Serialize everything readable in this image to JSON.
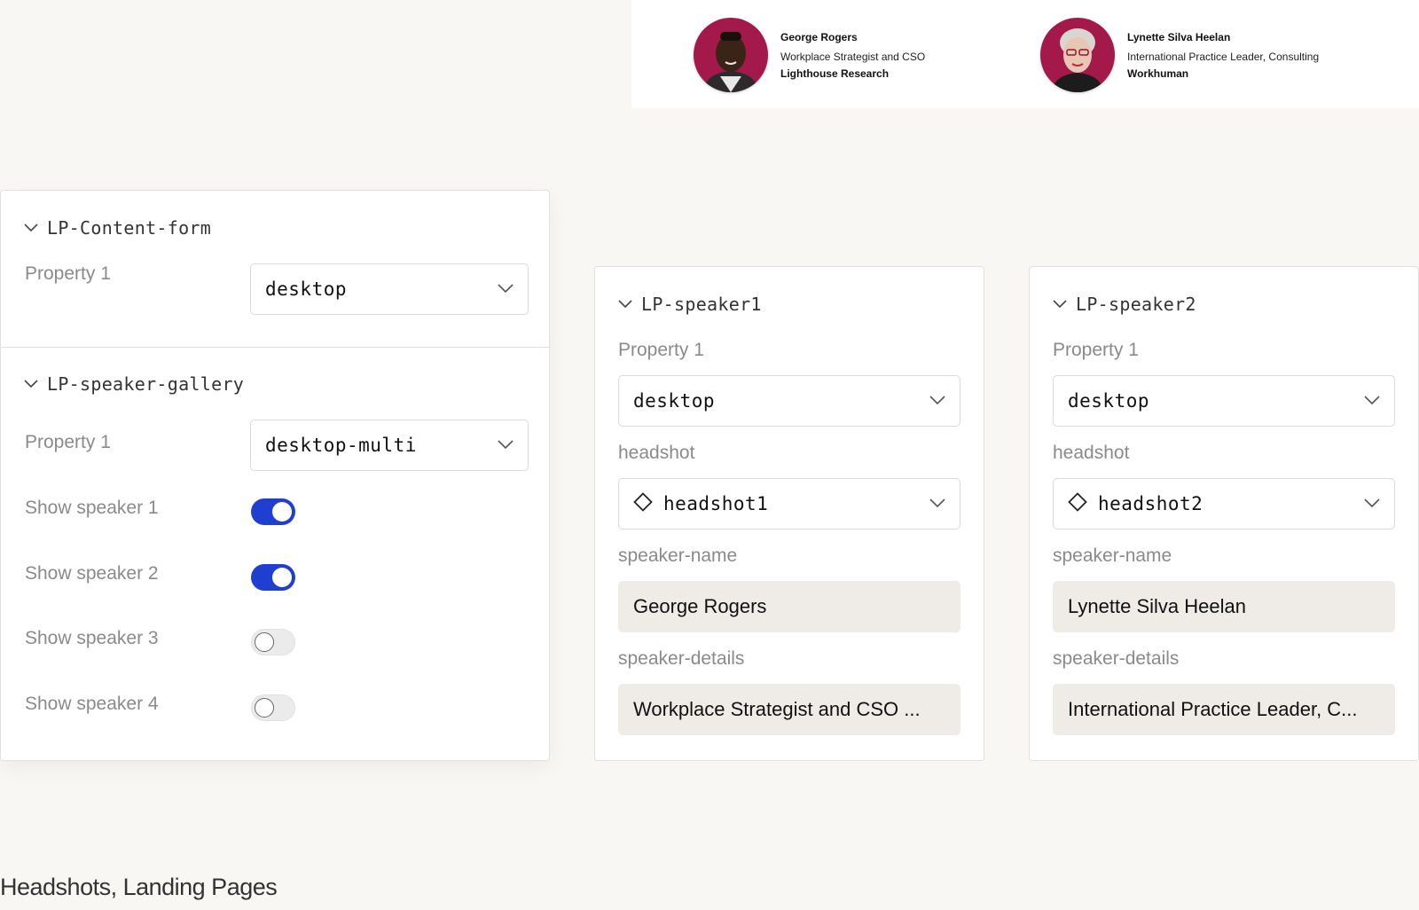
{
  "banner": {
    "speakers": [
      {
        "name": "George Rogers",
        "title": "Workplace Strategist and CSO",
        "company": "Lighthouse Research"
      },
      {
        "name": "Lynette Silva Heelan",
        "title": "International Practice Leader, Consulting",
        "company": "Workhuman"
      }
    ]
  },
  "content_form": {
    "title": "LP-Content-form",
    "property_label": "Property 1",
    "property_value": "desktop"
  },
  "gallery": {
    "title": "LP-speaker-gallery",
    "property_label": "Property 1",
    "property_value": "desktop-multi",
    "toggles": [
      {
        "label": "Show speaker 1",
        "on": true
      },
      {
        "label": "Show speaker 2",
        "on": true
      },
      {
        "label": "Show speaker 3",
        "on": false
      },
      {
        "label": "Show speaker 4",
        "on": false
      }
    ]
  },
  "speaker1": {
    "title": "LP-speaker1",
    "property_label": "Property 1",
    "property_value": "desktop",
    "headshot_label": "headshot",
    "headshot_value": "headshot1",
    "name_label": "speaker-name",
    "name_value": "George Rogers",
    "details_label": "speaker-details",
    "details_value": "Workplace Strategist and CSO ..."
  },
  "speaker2": {
    "title": "LP-speaker2",
    "property_label": "Property 1",
    "property_value": "desktop",
    "headshot_label": "headshot",
    "headshot_value": "headshot2",
    "name_label": "speaker-name",
    "name_value": "Lynette Silva Heelan",
    "details_label": "speaker-details",
    "details_value": "International Practice Leader, C..."
  },
  "footer": {
    "title": "Headshots, Landing Pages"
  },
  "colors": {
    "avatar_bg": "#a3194a",
    "toggle_on": "#1f3fd1",
    "field_bg": "#efebe6",
    "page_bg": "#f8f7f4"
  }
}
